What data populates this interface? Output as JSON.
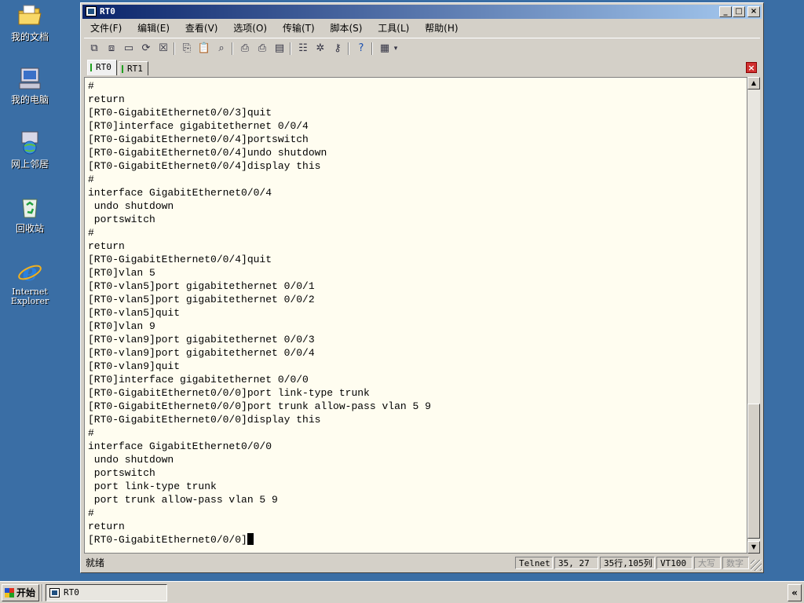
{
  "desktop": {
    "icons": [
      {
        "label": "我的文档",
        "icon": "folder-documents-icon"
      },
      {
        "label": "我的电脑",
        "icon": "computer-icon"
      },
      {
        "label": "网上邻居",
        "icon": "network-places-icon"
      },
      {
        "label": "回收站",
        "icon": "recycle-bin-icon"
      },
      {
        "label_line1": "Internet",
        "label_line2": "Explorer",
        "icon": "ie-icon"
      }
    ]
  },
  "window": {
    "title": "RT0",
    "controls": {
      "minimize": "_",
      "maximize": "□",
      "close": "×"
    },
    "menu": [
      "文件(F)",
      "编辑(E)",
      "查看(V)",
      "选项(O)",
      "传输(T)",
      "脚本(S)",
      "工具(L)",
      "帮助(H)"
    ],
    "tabs": [
      {
        "label": "RT0",
        "active": true
      },
      {
        "label": "RT1",
        "active": false
      }
    ],
    "tab_close": "×"
  },
  "terminal": {
    "lines": [
      "#",
      "return",
      "[RT0-GigabitEthernet0/0/3]quit",
      "[RT0]interface gigabitethernet 0/0/4",
      "[RT0-GigabitEthernet0/0/4]portswitch",
      "[RT0-GigabitEthernet0/0/4]undo shutdown",
      "[RT0-GigabitEthernet0/0/4]display this",
      "#",
      "interface GigabitEthernet0/0/4",
      " undo shutdown",
      " portswitch",
      "#",
      "return",
      "[RT0-GigabitEthernet0/0/4]quit",
      "[RT0]vlan 5",
      "[RT0-vlan5]port gigabitethernet 0/0/1",
      "[RT0-vlan5]port gigabitethernet 0/0/2",
      "[RT0-vlan5]quit",
      "[RT0]vlan 9",
      "[RT0-vlan9]port gigabitethernet 0/0/3",
      "[RT0-vlan9]port gigabitethernet 0/0/4",
      "[RT0-vlan9]quit",
      "[RT0]interface gigabitethernet 0/0/0",
      "[RT0-GigabitEthernet0/0/0]port link-type trunk",
      "[RT0-GigabitEthernet0/0/0]port trunk allow-pass vlan 5 9",
      "[RT0-GigabitEthernet0/0/0]display this",
      "#",
      "interface GigabitEthernet0/0/0",
      " undo shutdown",
      " portswitch",
      " port link-type trunk",
      " port trunk allow-pass vlan 5 9",
      "#",
      "return"
    ],
    "prompt": "[RT0-GigabitEthernet0/0/0]"
  },
  "statusbar": {
    "status": "就绪",
    "protocol": "Telnet",
    "cursor_pos": "35,  27",
    "size": "35行,105列",
    "emulation": "VT100",
    "caps": "大写",
    "num": "数字"
  },
  "taskbar": {
    "start_label": "开始",
    "task_label": "RT0",
    "tray_toggle": "«"
  }
}
